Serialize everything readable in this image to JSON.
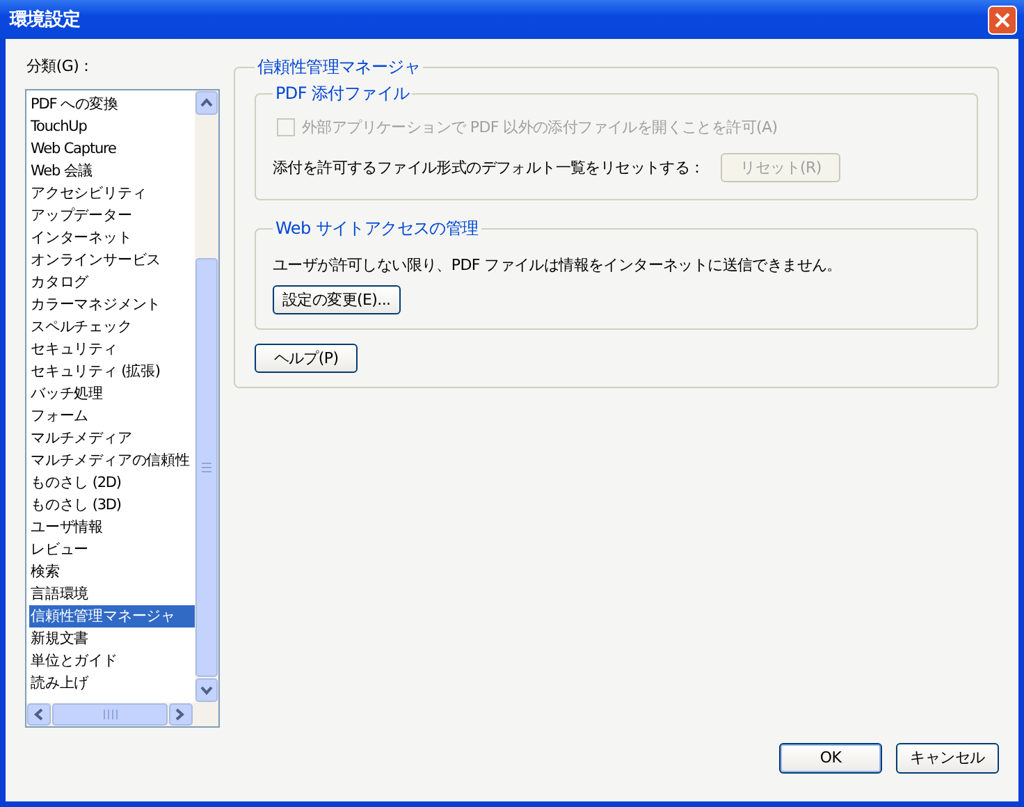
{
  "window": {
    "title": "環境設定"
  },
  "category_label": "分類(G)：",
  "categories": [
    {
      "label": "PDF への変換",
      "selected": false
    },
    {
      "label": "TouchUp",
      "selected": false
    },
    {
      "label": "Web Capture",
      "selected": false
    },
    {
      "label": "Web 会議",
      "selected": false
    },
    {
      "label": "アクセシビリティ",
      "selected": false
    },
    {
      "label": "アップデーター",
      "selected": false
    },
    {
      "label": "インターネット",
      "selected": false
    },
    {
      "label": "オンラインサービス",
      "selected": false
    },
    {
      "label": "カタログ",
      "selected": false
    },
    {
      "label": "カラーマネジメント",
      "selected": false
    },
    {
      "label": "スペルチェック",
      "selected": false
    },
    {
      "label": "セキュリティ",
      "selected": false
    },
    {
      "label": "セキュリティ (拡張)",
      "selected": false
    },
    {
      "label": "バッチ処理",
      "selected": false
    },
    {
      "label": "フォーム",
      "selected": false
    },
    {
      "label": "マルチメディア",
      "selected": false
    },
    {
      "label": "マルチメディアの信頼性",
      "selected": false
    },
    {
      "label": "ものさし (2D)",
      "selected": false
    },
    {
      "label": "ものさし (3D)",
      "selected": false
    },
    {
      "label": "ユーザ情報",
      "selected": false
    },
    {
      "label": "レビュー",
      "selected": false
    },
    {
      "label": "検索",
      "selected": false
    },
    {
      "label": "言語環境",
      "selected": false
    },
    {
      "label": "信頼性管理マネージャ",
      "selected": true
    },
    {
      "label": "新規文書",
      "selected": false
    },
    {
      "label": "単位とガイド",
      "selected": false
    },
    {
      "label": "読み上げ",
      "selected": false
    }
  ],
  "panel": {
    "title": "信頼性管理マネージャ",
    "attachments": {
      "title": "PDF 添付ファイル",
      "checkbox": {
        "label": "外部アプリケーションで PDF 以外の添付ファイルを開くことを許可(A)",
        "checked": false,
        "disabled": true
      },
      "reset_text": "添付を許可するファイル形式のデフォルト一覧をリセットする：",
      "reset_button": {
        "label": "リセット(R)",
        "disabled": true
      }
    },
    "web_access": {
      "title": "Web サイトアクセスの管理",
      "text": "ユーザが許可しない限り、PDF ファイルは情報をインターネットに送信できません。",
      "button": "設定の変更(E)..."
    },
    "help_button": "ヘルプ(P)"
  },
  "buttons": [
    "OK",
    "キャンセル"
  ]
}
